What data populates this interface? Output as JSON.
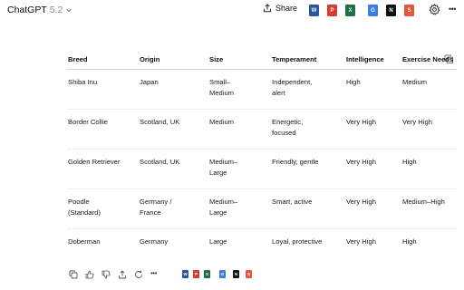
{
  "app": {
    "name": "ChatGPT",
    "version": "5.2"
  },
  "header": {
    "share_label": "Share"
  },
  "table": {
    "columns": [
      "Breed",
      "Origin",
      "Size",
      "Temperament",
      "Intelligence",
      "Exercise Needs"
    ],
    "rows": [
      [
        "Shiba Inu",
        "Japan",
        "Small–Medium",
        "Independent, alert",
        "High",
        "Medium"
      ],
      [
        "Border Collie",
        "Scotland, UK",
        "Medium",
        "Energetic, focused",
        "Very High",
        "Very High"
      ],
      [
        "Golden Retriever",
        "Scotland, UK",
        "Medium–Large",
        "Friendly, gentle",
        "Very High",
        "High"
      ],
      [
        "Poodle (Standard)",
        "Germany / France",
        "Medium–Large",
        "Smart, active",
        "Very High",
        "Medium–High"
      ],
      [
        "Doberman",
        "Germany",
        "Large",
        "Loyal, protective",
        "Very High",
        "High"
      ]
    ]
  },
  "colors": {
    "word": "#2b579a",
    "pdf": "#d83b2d",
    "excel": "#1e7145",
    "docs": "#3c7de6",
    "notion": "#111111",
    "slides": "#e8553b"
  },
  "icons": {
    "header": [
      "upload-icon",
      "word-icon",
      "pdf-icon",
      "excel-icon",
      "google-docs-icon",
      "notion-icon",
      "slides-icon",
      "gear-icon",
      "more-icon"
    ],
    "bottom": [
      "copy-icon",
      "thumbs-up-icon",
      "thumbs-down-icon",
      "share-icon",
      "regenerate-icon",
      "more-icon"
    ]
  }
}
